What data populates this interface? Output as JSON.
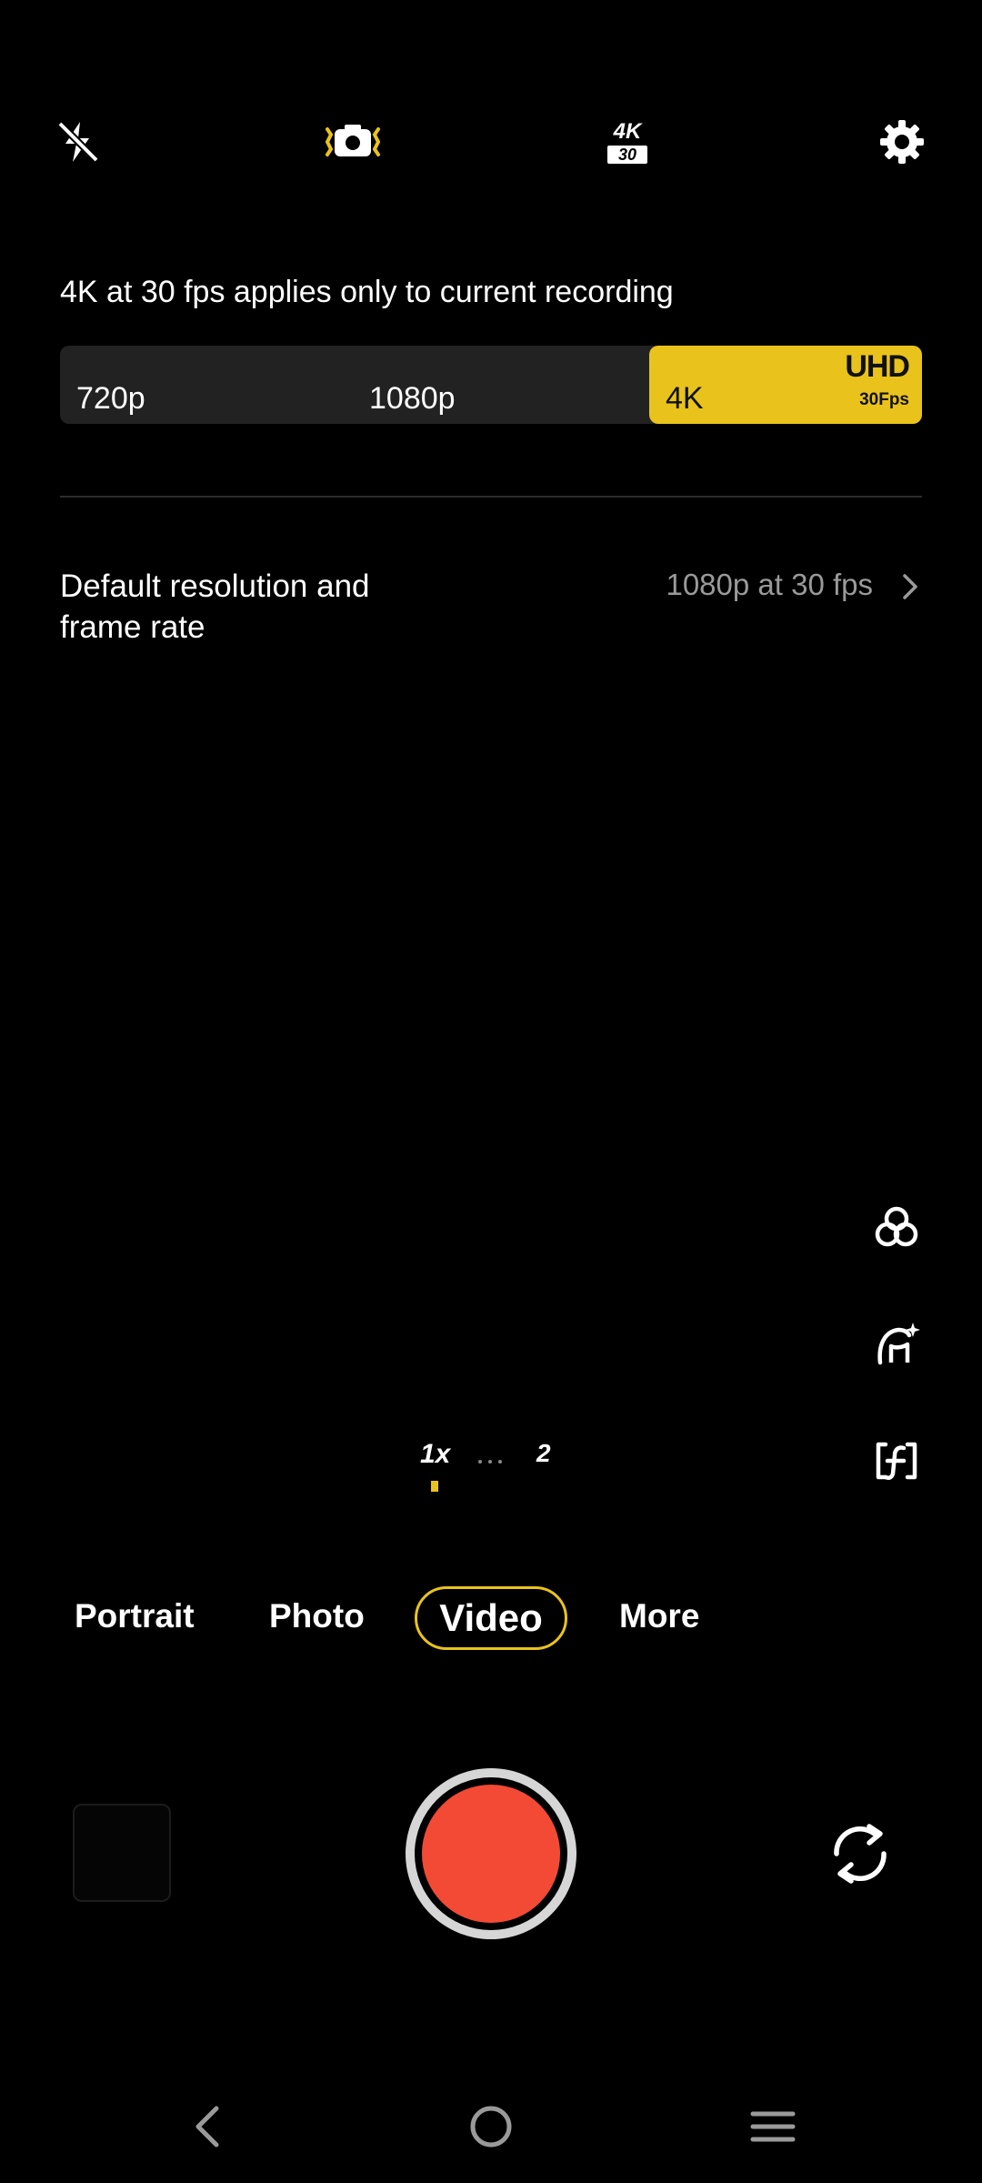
{
  "top_bar": {
    "icons": [
      "flash-off-icon",
      "stabilization-icon",
      "video-quality-4k30-icon",
      "settings-gear-icon"
    ],
    "quality_badge": {
      "resolution": "4K",
      "fps": "30"
    }
  },
  "resolution_panel": {
    "notice": "4K at 30 fps applies only to current recording",
    "options": [
      "720p",
      "1080p",
      "4K"
    ],
    "selected": "4K",
    "badge_main": "UHD",
    "badge_sub": "30Fps",
    "accent_color": "#e9c31c"
  },
  "default_setting": {
    "label": "Default resolution and frame rate",
    "value": "1080p at 30 fps"
  },
  "side_tools": [
    "filters-icon",
    "beauty-icon",
    "aperture-focus-icon"
  ],
  "zoom": {
    "options": [
      "1x",
      "2"
    ],
    "selected": "1x"
  },
  "modes": {
    "items": [
      "Portrait",
      "Photo",
      "Video",
      "More"
    ],
    "selected": "Video"
  },
  "bottom_controls": {
    "record_color": "#f24a34",
    "icons": [
      "gallery-thumbnail",
      "record-button",
      "switch-camera-icon"
    ]
  },
  "nav_bar": {
    "icons": [
      "back-icon",
      "home-icon",
      "recents-icon"
    ]
  }
}
